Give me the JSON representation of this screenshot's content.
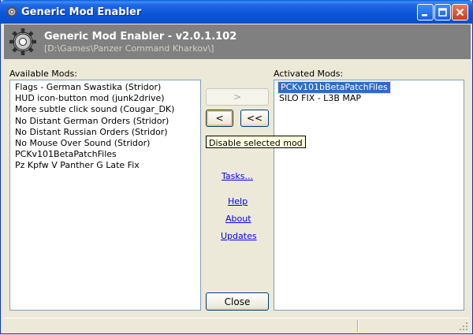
{
  "window": {
    "title": "Generic Mod Enabler"
  },
  "header": {
    "title": "Generic Mod Enabler - v2.0.1.102",
    "path": "[D:\\Games\\Panzer Command Kharkov\\]"
  },
  "available": {
    "label": "Available Mods:",
    "items": [
      "Flags - German Swastika (Stridor)",
      "HUD icon-button mod (junk2drive)",
      "More subtle click sound (Cougar_DK)",
      "No Distant German Orders (Stridor)",
      "No Distant Russian Orders  (Stridor)",
      "No Mouse Over Sound  (Stridor)",
      "PCKv101BetaPatchFiles",
      "Pz Kpfw V Panther G Late Fix"
    ]
  },
  "activated": {
    "label": "Activated Mods:",
    "items": [
      "PCKv101bBetaPatchFiles",
      "SILO FIX - L3B MAP"
    ],
    "selected_index": 0
  },
  "buttons": {
    "enable": ">",
    "disable": "<",
    "disable_all": "<<",
    "close": "Close"
  },
  "tooltip": "Disable selected mod",
  "links": {
    "tasks": "Tasks...",
    "help": "Help",
    "about": "About",
    "updates": "Updates"
  },
  "colors": {
    "titlebar": "#0a54d9",
    "header_bg": "#808080",
    "selection": "#316ac5",
    "link": "#0000ff"
  }
}
